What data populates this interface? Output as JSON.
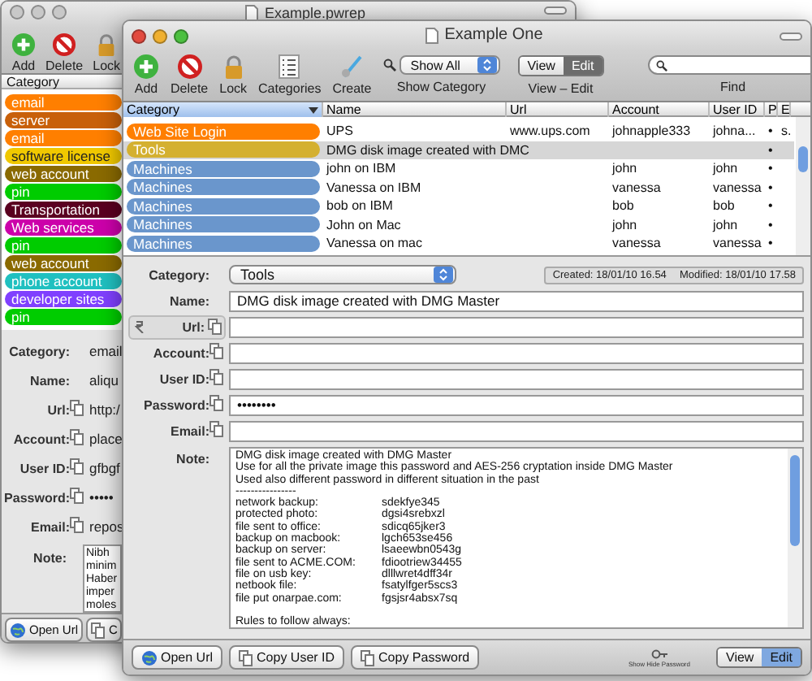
{
  "back_window": {
    "title": "Example.pwrep",
    "toolbar": [
      {
        "kind": "add",
        "label": "Add"
      },
      {
        "kind": "delete",
        "label": "Delete"
      },
      {
        "kind": "lock",
        "label": "Lock"
      }
    ],
    "list_header": "Category",
    "categories": [
      {
        "label": "email",
        "color": "#ff7f00"
      },
      {
        "label": "server",
        "color": "#c8600a"
      },
      {
        "label": "email",
        "color": "#ff7f00"
      },
      {
        "label": "software license",
        "color": "#f0c800"
      },
      {
        "label": "web account",
        "color": "#8a6a00"
      },
      {
        "label": "pin",
        "color": "#00cc00"
      },
      {
        "label": "Transportation",
        "color": "#5a0020"
      },
      {
        "label": "Web services",
        "color": "#cc00aa"
      },
      {
        "label": "pin",
        "color": "#00cc00"
      },
      {
        "label": "web account",
        "color": "#8a6a00"
      },
      {
        "label": "phone account",
        "color": "#20c0c0"
      },
      {
        "label": "developer sites",
        "color": "#8040ff"
      },
      {
        "label": "pin",
        "color": "#00cc00"
      }
    ],
    "details": [
      {
        "label": "Category:",
        "value": "email",
        "copy": false
      },
      {
        "label": "Name:",
        "value": "aliqu",
        "copy": false
      },
      {
        "label": "Url:",
        "value": "http:/",
        "copy": true
      },
      {
        "label": "Account:",
        "value": "place",
        "copy": true
      },
      {
        "label": "User ID:",
        "value": "gfbgf",
        "copy": true
      },
      {
        "label": "Password:",
        "value": "•••••",
        "copy": true
      },
      {
        "label": "Email:",
        "value": "repos",
        "copy": true
      }
    ],
    "note": {
      "label": "Note:",
      "lines": [
        "Nibh",
        "minim",
        "Haber",
        "imper",
        "moles"
      ]
    },
    "buttons": [
      {
        "kind": "open",
        "label": "Open Url"
      },
      {
        "kind": "copy",
        "label": "C"
      }
    ]
  },
  "front_window": {
    "title": "Example One",
    "toolbar": [
      {
        "kind": "add",
        "label": "Add"
      },
      {
        "kind": "delete",
        "label": "Delete"
      },
      {
        "kind": "lock",
        "label": "Lock"
      },
      {
        "kind": "categories",
        "label": "Categories"
      },
      {
        "kind": "create",
        "label": "Create"
      }
    ],
    "show_filter": {
      "value": "Show All",
      "label": "Show Category"
    },
    "mode_switch": {
      "label": "View – Edit",
      "options": [
        {
          "label": "View",
          "selected": false
        },
        {
          "label": "Edit",
          "selected": true
        }
      ]
    },
    "find": {
      "label": "Find"
    },
    "table": {
      "columns": [
        "Category",
        "Name",
        "Url",
        "Account",
        "User ID",
        "P",
        "E"
      ],
      "rows": [
        {
          "category": "Web Site Login",
          "color": "#ff7f00",
          "name": "UPS",
          "url": "www.ups.com",
          "account": "johnapple333",
          "user_id": "johna...",
          "p": "•",
          "e": "s.",
          "selected": false
        },
        {
          "category": "Tools",
          "color": "#d4b030",
          "name": "DMG disk image created with DMC",
          "p": "•",
          "selected": true
        },
        {
          "category": "Machines",
          "color": "#6a96cc",
          "name": "john on IBM",
          "account": "john",
          "user_id": "john",
          "p": "•",
          "selected": false
        },
        {
          "category": "Machines",
          "color": "#6a96cc",
          "name": "Vanessa on IBM",
          "account": "vanessa",
          "user_id": "vanessa",
          "p": "•",
          "selected": false
        },
        {
          "category": "Machines",
          "color": "#6a96cc",
          "name": "bob on IBM",
          "account": "bob",
          "user_id": "bob",
          "p": "•",
          "selected": false
        },
        {
          "category": "Machines",
          "color": "#6a96cc",
          "name": "John on Mac",
          "account": "john",
          "user_id": "john",
          "p": "•",
          "selected": false
        },
        {
          "category": "Machines",
          "color": "#6a96cc",
          "name": "Vanessa on mac",
          "account": "vanessa",
          "user_id": "vanessa",
          "p": "•",
          "selected": false
        }
      ]
    },
    "category": {
      "label": "Category:",
      "value": "Tools"
    },
    "timestamps": [
      "Created: 18/01/10 16.54",
      "Modified: 18/01/10 17.58"
    ],
    "fields": [
      {
        "kind": "text",
        "label": "Name:",
        "value": "DMG disk image created with DMG Master",
        "copy": false
      },
      {
        "kind": "link",
        "label": "Url:",
        "copy": true
      },
      {
        "kind": "text",
        "label": "Account:",
        "copy": true
      },
      {
        "kind": "text",
        "label": "User ID:",
        "copy": true
      },
      {
        "kind": "text",
        "label": "Password:",
        "value": "••••••••",
        "copy": true
      },
      {
        "kind": "text",
        "label": "Email:",
        "copy": true
      }
    ],
    "note": {
      "label": "Note:",
      "lines": [
        "DMG disk image created with DMG Master",
        "Use for all the private image this password and AES-256 cryptation inside DMG Master",
        "Used also different password in different situation in the past"
      ],
      "separator": "----------------",
      "entries": [
        {
          "label": "network backup:",
          "value": "sdekfye345"
        },
        {
          "label": "protected photo:",
          "value": "dgsi4srebxzl"
        },
        {
          "label": "file sent to office:",
          "value": "sdicq65jker3"
        },
        {
          "label": "backup on macbook:",
          "value": "lgch653se456"
        },
        {
          "label": "backup on server:",
          "value": "lsaeewbn0543g"
        },
        {
          "label": "file sent to ACME.COM:",
          "value": "fdiootriew34455"
        },
        {
          "label": "file on usb key:",
          "value": "dlllwret4dff34r"
        },
        {
          "label": "netbook file:",
          "value": "fsatylfger5scs3"
        },
        {
          "label": "file put onarpae.com:",
          "value": "fgsjsr4absx7sq"
        }
      ],
      "footer": "Rules to follow always:"
    },
    "buttons": [
      {
        "kind": "open",
        "label": "Open Url"
      },
      {
        "kind": "copy",
        "label": "Copy User ID"
      },
      {
        "kind": "copy",
        "label": "Copy Password"
      }
    ],
    "password_toggle": "Show Hide Password",
    "bottom_switch": {
      "options": [
        {
          "label": "View",
          "selected": false
        },
        {
          "label": "Edit",
          "selected": true
        }
      ]
    }
  }
}
